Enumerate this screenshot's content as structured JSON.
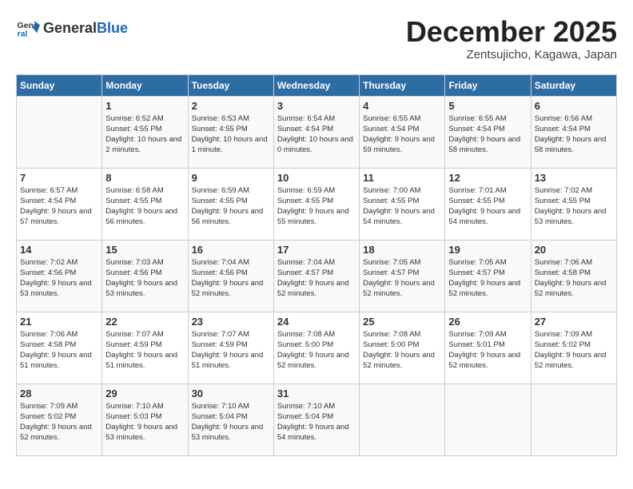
{
  "header": {
    "logo_general": "General",
    "logo_blue": "Blue",
    "month_title": "December 2025",
    "subtitle": "Zentsujicho, Kagawa, Japan"
  },
  "days_of_week": [
    "Sunday",
    "Monday",
    "Tuesday",
    "Wednesday",
    "Thursday",
    "Friday",
    "Saturday"
  ],
  "weeks": [
    [
      {
        "day": "",
        "sunrise": "",
        "sunset": "",
        "daylight": ""
      },
      {
        "day": "1",
        "sunrise": "Sunrise: 6:52 AM",
        "sunset": "Sunset: 4:55 PM",
        "daylight": "Daylight: 10 hours and 2 minutes."
      },
      {
        "day": "2",
        "sunrise": "Sunrise: 6:53 AM",
        "sunset": "Sunset: 4:55 PM",
        "daylight": "Daylight: 10 hours and 1 minute."
      },
      {
        "day": "3",
        "sunrise": "Sunrise: 6:54 AM",
        "sunset": "Sunset: 4:54 PM",
        "daylight": "Daylight: 10 hours and 0 minutes."
      },
      {
        "day": "4",
        "sunrise": "Sunrise: 6:55 AM",
        "sunset": "Sunset: 4:54 PM",
        "daylight": "Daylight: 9 hours and 59 minutes."
      },
      {
        "day": "5",
        "sunrise": "Sunrise: 6:55 AM",
        "sunset": "Sunset: 4:54 PM",
        "daylight": "Daylight: 9 hours and 58 minutes."
      },
      {
        "day": "6",
        "sunrise": "Sunrise: 6:56 AM",
        "sunset": "Sunset: 4:54 PM",
        "daylight": "Daylight: 9 hours and 58 minutes."
      }
    ],
    [
      {
        "day": "7",
        "sunrise": "Sunrise: 6:57 AM",
        "sunset": "Sunset: 4:54 PM",
        "daylight": "Daylight: 9 hours and 57 minutes."
      },
      {
        "day": "8",
        "sunrise": "Sunrise: 6:58 AM",
        "sunset": "Sunset: 4:55 PM",
        "daylight": "Daylight: 9 hours and 56 minutes."
      },
      {
        "day": "9",
        "sunrise": "Sunrise: 6:59 AM",
        "sunset": "Sunset: 4:55 PM",
        "daylight": "Daylight: 9 hours and 56 minutes."
      },
      {
        "day": "10",
        "sunrise": "Sunrise: 6:59 AM",
        "sunset": "Sunset: 4:55 PM",
        "daylight": "Daylight: 9 hours and 55 minutes."
      },
      {
        "day": "11",
        "sunrise": "Sunrise: 7:00 AM",
        "sunset": "Sunset: 4:55 PM",
        "daylight": "Daylight: 9 hours and 54 minutes."
      },
      {
        "day": "12",
        "sunrise": "Sunrise: 7:01 AM",
        "sunset": "Sunset: 4:55 PM",
        "daylight": "Daylight: 9 hours and 54 minutes."
      },
      {
        "day": "13",
        "sunrise": "Sunrise: 7:02 AM",
        "sunset": "Sunset: 4:55 PM",
        "daylight": "Daylight: 9 hours and 53 minutes."
      }
    ],
    [
      {
        "day": "14",
        "sunrise": "Sunrise: 7:02 AM",
        "sunset": "Sunset: 4:56 PM",
        "daylight": "Daylight: 9 hours and 53 minutes."
      },
      {
        "day": "15",
        "sunrise": "Sunrise: 7:03 AM",
        "sunset": "Sunset: 4:56 PM",
        "daylight": "Daylight: 9 hours and 53 minutes."
      },
      {
        "day": "16",
        "sunrise": "Sunrise: 7:04 AM",
        "sunset": "Sunset: 4:56 PM",
        "daylight": "Daylight: 9 hours and 52 minutes."
      },
      {
        "day": "17",
        "sunrise": "Sunrise: 7:04 AM",
        "sunset": "Sunset: 4:57 PM",
        "daylight": "Daylight: 9 hours and 52 minutes."
      },
      {
        "day": "18",
        "sunrise": "Sunrise: 7:05 AM",
        "sunset": "Sunset: 4:57 PM",
        "daylight": "Daylight: 9 hours and 52 minutes."
      },
      {
        "day": "19",
        "sunrise": "Sunrise: 7:05 AM",
        "sunset": "Sunset: 4:57 PM",
        "daylight": "Daylight: 9 hours and 52 minutes."
      },
      {
        "day": "20",
        "sunrise": "Sunrise: 7:06 AM",
        "sunset": "Sunset: 4:58 PM",
        "daylight": "Daylight: 9 hours and 52 minutes."
      }
    ],
    [
      {
        "day": "21",
        "sunrise": "Sunrise: 7:06 AM",
        "sunset": "Sunset: 4:58 PM",
        "daylight": "Daylight: 9 hours and 51 minutes."
      },
      {
        "day": "22",
        "sunrise": "Sunrise: 7:07 AM",
        "sunset": "Sunset: 4:59 PM",
        "daylight": "Daylight: 9 hours and 51 minutes."
      },
      {
        "day": "23",
        "sunrise": "Sunrise: 7:07 AM",
        "sunset": "Sunset: 4:59 PM",
        "daylight": "Daylight: 9 hours and 51 minutes."
      },
      {
        "day": "24",
        "sunrise": "Sunrise: 7:08 AM",
        "sunset": "Sunset: 5:00 PM",
        "daylight": "Daylight: 9 hours and 52 minutes."
      },
      {
        "day": "25",
        "sunrise": "Sunrise: 7:08 AM",
        "sunset": "Sunset: 5:00 PM",
        "daylight": "Daylight: 9 hours and 52 minutes."
      },
      {
        "day": "26",
        "sunrise": "Sunrise: 7:09 AM",
        "sunset": "Sunset: 5:01 PM",
        "daylight": "Daylight: 9 hours and 52 minutes."
      },
      {
        "day": "27",
        "sunrise": "Sunrise: 7:09 AM",
        "sunset": "Sunset: 5:02 PM",
        "daylight": "Daylight: 9 hours and 52 minutes."
      }
    ],
    [
      {
        "day": "28",
        "sunrise": "Sunrise: 7:09 AM",
        "sunset": "Sunset: 5:02 PM",
        "daylight": "Daylight: 9 hours and 52 minutes."
      },
      {
        "day": "29",
        "sunrise": "Sunrise: 7:10 AM",
        "sunset": "Sunset: 5:03 PM",
        "daylight": "Daylight: 9 hours and 53 minutes."
      },
      {
        "day": "30",
        "sunrise": "Sunrise: 7:10 AM",
        "sunset": "Sunset: 5:04 PM",
        "daylight": "Daylight: 9 hours and 53 minutes."
      },
      {
        "day": "31",
        "sunrise": "Sunrise: 7:10 AM",
        "sunset": "Sunset: 5:04 PM",
        "daylight": "Daylight: 9 hours and 54 minutes."
      },
      {
        "day": "",
        "sunrise": "",
        "sunset": "",
        "daylight": ""
      },
      {
        "day": "",
        "sunrise": "",
        "sunset": "",
        "daylight": ""
      },
      {
        "day": "",
        "sunrise": "",
        "sunset": "",
        "daylight": ""
      }
    ]
  ]
}
